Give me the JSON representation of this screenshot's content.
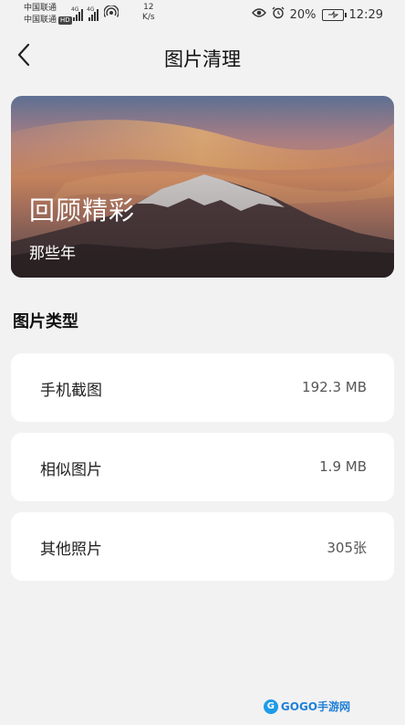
{
  "status_bar": {
    "carrier_1": "中国联通",
    "carrier_2": "中国联通",
    "hd_badge": "HD",
    "net_tag_1": "4G",
    "net_tag_2": "4G",
    "net_speed_value": "12",
    "net_speed_unit": "K/s",
    "battery_percent": "20%",
    "time": "12:29"
  },
  "header": {
    "title": "图片清理",
    "back_icon": "chevron-left-icon"
  },
  "banner": {
    "title": "回顾精彩",
    "subtitle": "那些年"
  },
  "section": {
    "title": "图片类型"
  },
  "categories": [
    {
      "label": "手机截图",
      "value": "192.3 MB"
    },
    {
      "label": "相似图片",
      "value": "1.9 MB"
    },
    {
      "label": "其他照片",
      "value": "305张"
    }
  ],
  "watermark": {
    "text": "GOGO手游网"
  },
  "colors": {
    "background": "#f2f2f2",
    "card": "#ffffff",
    "accent": "#1e7fd8"
  }
}
